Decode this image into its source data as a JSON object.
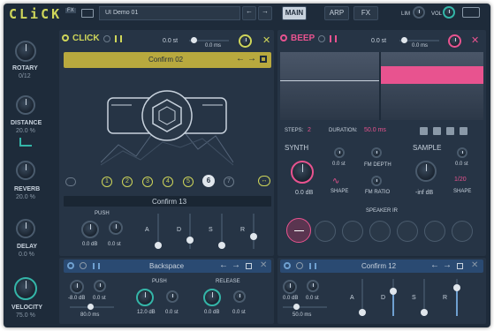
{
  "app": {
    "logo": "CLiCK",
    "badge": "FX",
    "preset": "UI Demo 01",
    "modes": [
      "MAIN",
      "ARP",
      "FX"
    ],
    "lim": "LIM",
    "vol": "VOL"
  },
  "sidebar": [
    {
      "label": "ROTARY",
      "value": "0/12"
    },
    {
      "label": "DISTANCE",
      "value": "20.0 %"
    },
    {
      "label": "REVERB",
      "value": "20.0 %"
    },
    {
      "label": "DELAY",
      "value": "0.0 %"
    },
    {
      "label": "VELOCITY",
      "value": "75.0 %"
    }
  ],
  "click": {
    "title": "CLICK",
    "pitch": "0.0 st",
    "time": "0.0 ms",
    "sample": "Confirm 02",
    "steps": [
      "1",
      "2",
      "3",
      "4",
      "5",
      "6",
      "7"
    ],
    "active_step": "6",
    "sub_sample": "Confirm 13",
    "push": "PUSH",
    "push_db": "0.0 dB",
    "push_st": "0.0 st",
    "adsr": [
      "A",
      "D",
      "S",
      "R"
    ]
  },
  "beep": {
    "title": "BEEP",
    "pitch": "0.0 st",
    "time": "0.0 ms",
    "steps_label": "STEPS:",
    "steps_value": "2",
    "duration_label": "DURATION:",
    "duration_value": "50.0 ms",
    "synth": "SYNTH",
    "synth_db": "0.0 dB",
    "st_val": "0.0 st",
    "shape": "SHAPE",
    "fm_depth": "FM DEPTH",
    "fm_ratio": "FM RATIO",
    "sample": "SAMPLE",
    "sample_db": "-inf dB",
    "sample_st": "0.0 st",
    "sample_shape": "SHAPE",
    "shape_val": "1/20",
    "speaker_ir": "SPEAKER IR"
  },
  "layer_left": {
    "name": "Backspace",
    "db": "-8.0 dB",
    "st": "0.0 st",
    "time": "80.0 ms",
    "push": "PUSH",
    "push_db": "12.0 dB",
    "push_st": "0.0 st",
    "release": "RELEASE",
    "rel_db": "0.0 dB",
    "rel_st": "0.0 st"
  },
  "layer_right": {
    "name": "Confirm 12",
    "db": "0.0 dB",
    "st": "0.0 st",
    "time": "50.0 ms",
    "adsr": [
      "A",
      "D",
      "S",
      "R"
    ]
  },
  "colors": {
    "accent_yellow": "#cfd65a",
    "accent_pink": "#e8538f",
    "accent_teal": "#34b5a8",
    "bg": "#1e2b3a"
  }
}
